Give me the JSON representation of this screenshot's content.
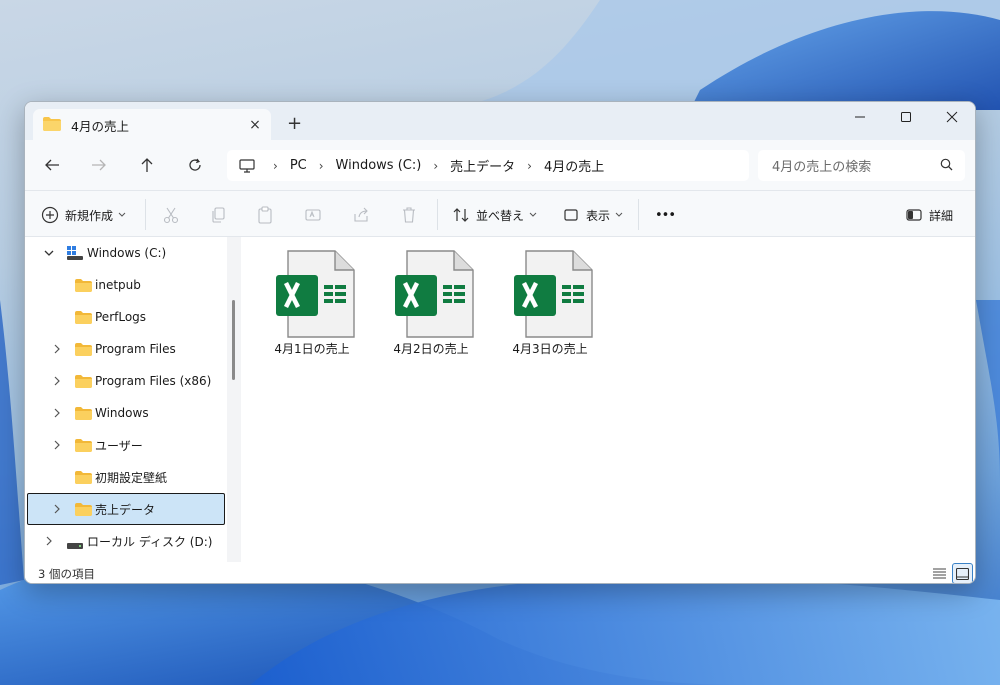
{
  "window": {
    "tab_title": "4月の売上",
    "tab_close": "×",
    "new_tab": "+"
  },
  "address_bar": {
    "crumbs": [
      "PC",
      "Windows (C:)",
      "売上データ",
      "4月の売上"
    ],
    "separator": "›"
  },
  "search": {
    "placeholder": "4月の売上の検索"
  },
  "toolbar": {
    "new_label": "新規作成",
    "sort_label": "並べ替え",
    "view_label": "表示",
    "more_label": "•••",
    "details_label": "詳細"
  },
  "sidebar": {
    "items": [
      {
        "label": "Windows (C:)",
        "icon": "windows-drive-icon",
        "expanded": true
      },
      {
        "label": "inetpub",
        "icon": "folder-icon"
      },
      {
        "label": "PerfLogs",
        "icon": "folder-icon"
      },
      {
        "label": "Program Files",
        "icon": "folder-icon"
      },
      {
        "label": "Program Files (x86)",
        "icon": "folder-icon"
      },
      {
        "label": "Windows",
        "icon": "folder-icon"
      },
      {
        "label": "ユーザー",
        "icon": "folder-icon"
      },
      {
        "label": "初期設定壁紙",
        "icon": "folder-icon"
      },
      {
        "label": "売上データ",
        "icon": "folder-icon",
        "selected": true
      },
      {
        "label": "ローカル ディスク (D:)",
        "icon": "drive-icon"
      }
    ]
  },
  "files": [
    {
      "name": "4月1日の売上",
      "icon": "excel-file-icon"
    },
    {
      "name": "4月2日の売上",
      "icon": "excel-file-icon"
    },
    {
      "name": "4月3日の売上",
      "icon": "excel-file-icon"
    }
  ],
  "status": {
    "item_count": "3 個の項目"
  },
  "colors": {
    "excel_green": "#107c41",
    "folder_yellow": "#f8c54a",
    "selection": "#cce4f7",
    "accent": "#3b82c6"
  }
}
